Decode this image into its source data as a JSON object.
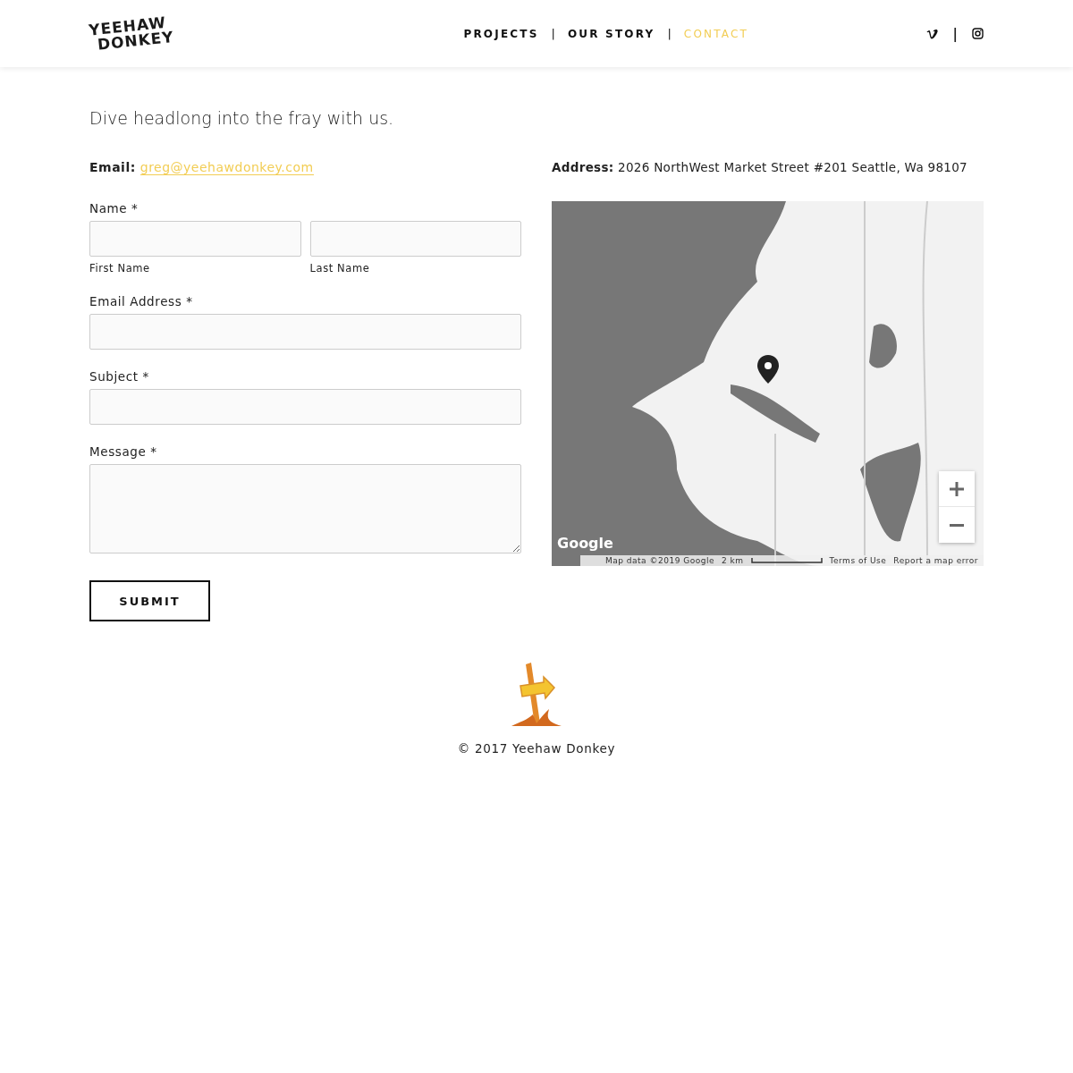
{
  "header": {
    "logo": [
      "YEEHAW",
      "DONKEY"
    ],
    "nav": [
      {
        "kind": "link",
        "label": "PROJECTS",
        "selected": false
      },
      {
        "kind": "separator",
        "label": "|"
      },
      {
        "kind": "link",
        "label": "OUR STORY",
        "selected": false
      },
      {
        "kind": "separator",
        "label": "|"
      },
      {
        "kind": "link",
        "label": "CONTACT",
        "selected": true
      }
    ],
    "social": [
      {
        "kind": "vimeo"
      },
      {
        "kind": "separator",
        "label": "|"
      },
      {
        "kind": "instagram"
      }
    ]
  },
  "intro": "Dive headlong into the fray with us.",
  "email": {
    "label": "Email:",
    "value": "greg@yeehawdonkey.com"
  },
  "address": {
    "label": "Address:",
    "value": "2026 NorthWest Market Street #201 Seattle, Wa 98107"
  },
  "form": {
    "fields": [
      {
        "kind": "name",
        "label": "Name *",
        "parts": [
          "First Name",
          "Last Name"
        ]
      },
      {
        "kind": "text",
        "label": "Email Address *"
      },
      {
        "kind": "text",
        "label": "Subject *"
      },
      {
        "kind": "textarea",
        "label": "Message *"
      }
    ],
    "submit": "SUBMIT"
  },
  "map": {
    "logo": "Google",
    "attribution": "Map data ©2019 Google",
    "scale": "2 km",
    "terms": "Terms of Use",
    "report": "Report a map error"
  },
  "footer": {
    "copyright": "© 2017 Yeehaw Donkey"
  }
}
